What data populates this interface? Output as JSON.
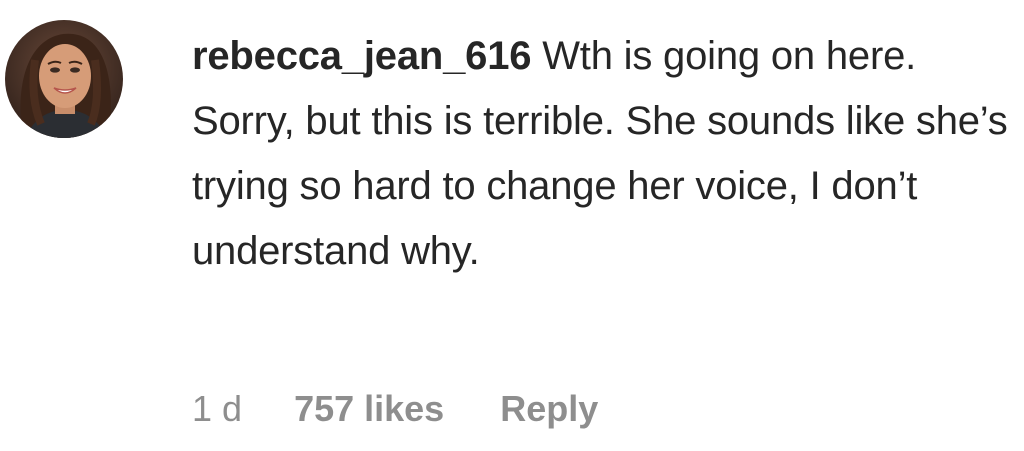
{
  "comment": {
    "username": "rebecca_jean_616",
    "text": "Wth is going on here. Sorry, but this is terrible. She sounds like she’s trying so hard to change her voice, I don’t understand why.",
    "timestamp": "1 d",
    "likes": "757 likes",
    "reply_label": "Reply",
    "avatar_icon": "user-avatar-photo"
  },
  "colors": {
    "text": "#262626",
    "meta": "#8e8e8e",
    "background": "#ffffff"
  }
}
